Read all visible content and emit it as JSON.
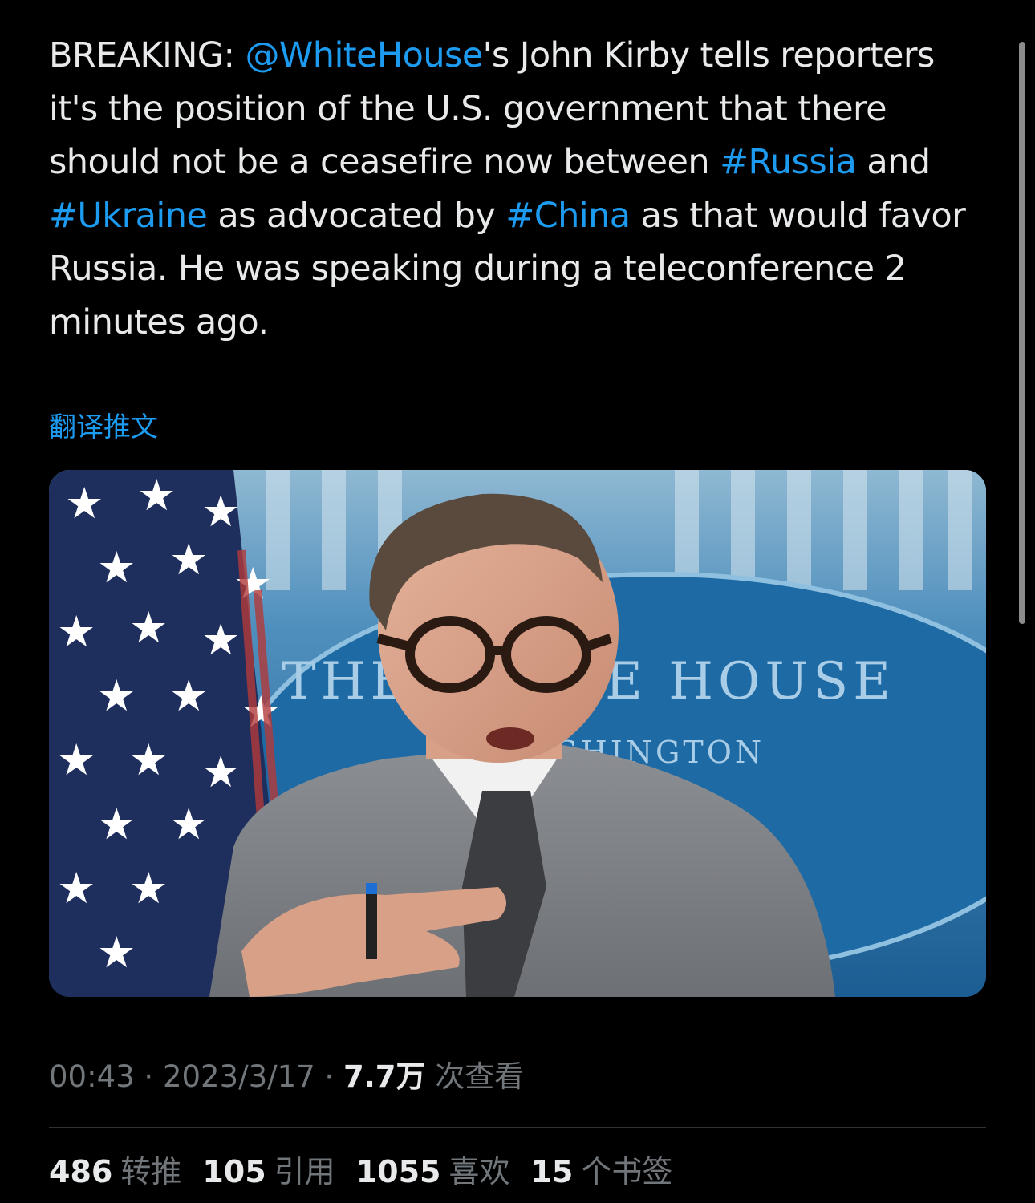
{
  "tweet": {
    "text_parts": [
      {
        "t": "BREAKING: ",
        "link": false
      },
      {
        "t": "@WhiteHouse",
        "link": true
      },
      {
        "t": "'s John Kirby tells reporters it's the position of the U.S. government that there should not be a ceasefire now between ",
        "link": false
      },
      {
        "t": "#Russia",
        "link": true
      },
      {
        "t": " and ",
        "link": false
      },
      {
        "t": "#Ukraine",
        "link": true
      },
      {
        "t": " as advocated by ",
        "link": false
      },
      {
        "t": "#China",
        "link": true
      },
      {
        "t": " as that would favor Russia. He was speaking during a teleconference 2 minutes ago.",
        "link": false
      }
    ],
    "translate_label": "翻译推文",
    "media_sign_text_1": "THE WHITE HOUSE",
    "media_sign_text_2": "WASHINGTON"
  },
  "meta": {
    "time": "00:43",
    "sep1": " · ",
    "date": "2023/3/17",
    "sep2": " · ",
    "views_count": "7.7万",
    "views_label": " 次查看"
  },
  "stats": {
    "retweets": {
      "num": "486",
      "label": "转推"
    },
    "quotes": {
      "num": "105",
      "label": "引用"
    },
    "likes": {
      "num": "1055",
      "label": "喜欢"
    },
    "bookmarks": {
      "num": "15",
      "label": "个书签"
    }
  },
  "colors": {
    "background": "#000000",
    "text": "#e7e9ea",
    "link": "#1d9bf0",
    "muted": "#71767b"
  }
}
